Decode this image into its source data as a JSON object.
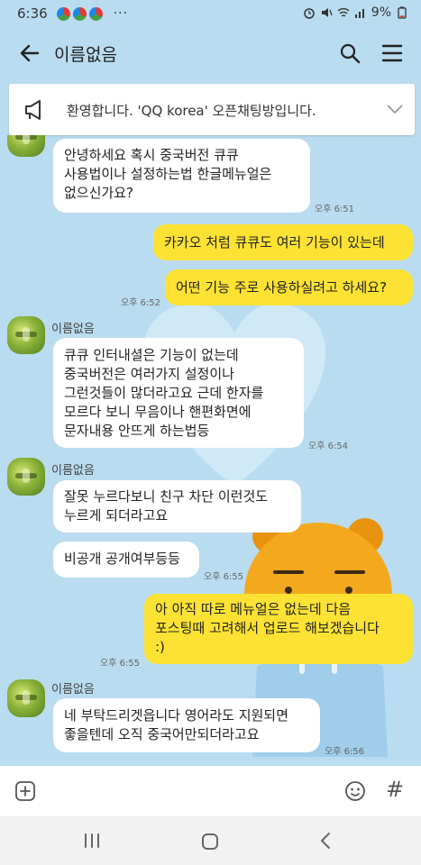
{
  "status_bar": {
    "time": "6:36",
    "more": "···",
    "battery": "9%"
  },
  "header": {
    "title": "이름없음",
    "back_icon": "arrow-left-icon",
    "search_icon": "search-icon",
    "menu_icon": "hamburger-menu-icon"
  },
  "notice": {
    "text": "환영합니다. 'QQ korea' 오픈채팅방입니다.",
    "icon": "megaphone-icon",
    "chevron": "chevron-down-icon"
  },
  "messages": [
    {
      "side": "in",
      "text": "안녕하세요 혹시 중국버전 큐큐\n사용법이나 설정하는법 한글메뉴얼은\n없으신가요?",
      "time": "오후 6:51"
    },
    {
      "side": "out",
      "text": "카카오 처럼 큐큐도 여러 기능이 있는데",
      "time": ""
    },
    {
      "side": "out",
      "text": "어떤 기능 주로 사용하실려고 하세요?",
      "time": "오후 6:52"
    },
    {
      "side": "in",
      "sender": "이름없음",
      "text": "큐큐 인터내셜은 기능이 없는데\n중국버전은 여러가지 설정이나\n그런것들이 많더라고요 근데 한자를\n모르다 보니 무음이나 핸편화면에\n문자내용 안뜨게 하는법등",
      "time": "오후 6:54"
    },
    {
      "side": "in",
      "sender": "이름없음",
      "text": "잘못 누르다보니 친구 차단 이런것도\n누르게 되더라고요",
      "time": ""
    },
    {
      "side": "in",
      "text": "비공개 공개여부등등",
      "time": "오후 6:55"
    },
    {
      "side": "out",
      "text": "아 아직 따로 메뉴얼은 없는데 다음\n포스팅때 고려해서 업로드 해보겠습니다\n:)",
      "time": "오후 6:55"
    },
    {
      "side": "in",
      "sender": "이름없음",
      "text": "네 부탁드리겟읍니다 영어라도 지원되면\n좋을텐데 오직 중국어만되더라고요",
      "time": "오후 6:56"
    }
  ],
  "input_bar": {
    "plus_icon": "plus-box-icon",
    "emoji_icon": "emoji-icon",
    "hash_icon": "hash-icon",
    "hash_glyph": "#"
  },
  "colors": {
    "background": "#b9dcf0",
    "outgoing_bubble": "#fde233",
    "incoming_bubble": "#ffffff"
  }
}
